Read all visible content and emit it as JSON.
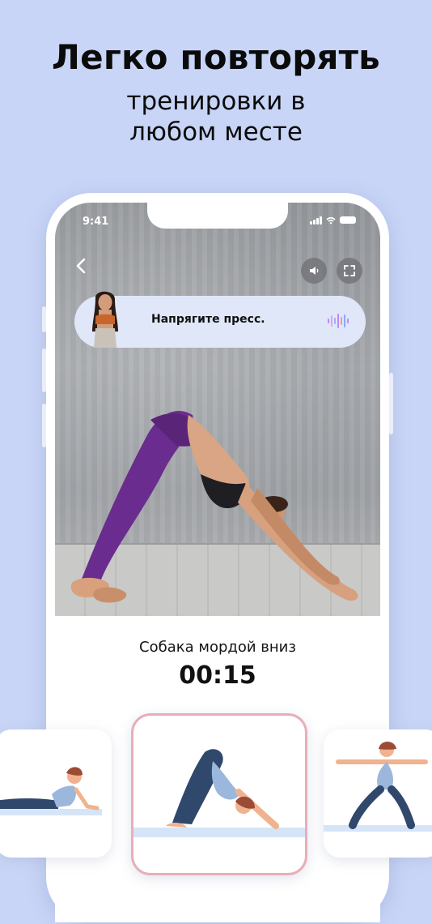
{
  "headline": {
    "title": "Легко повторять",
    "subtitle_line1": "тренировки в",
    "subtitle_line2": "любом месте"
  },
  "status_bar": {
    "time": "9:41"
  },
  "video_controls": {
    "back_icon": "chevron-left-icon",
    "sound_icon": "speaker-icon",
    "fullscreen_icon": "fullscreen-icon"
  },
  "coach_bubble": {
    "message": "Напрягите пресс.",
    "icon": "voice-wave-icon"
  },
  "exercise": {
    "name": "Собака мордой вниз",
    "timer": "00:15"
  },
  "pose_cards": [
    {
      "pose": "cobra-pose-icon",
      "selected": false
    },
    {
      "pose": "downward-dog-pose-icon",
      "selected": true
    },
    {
      "pose": "warrior-pose-icon",
      "selected": false
    }
  ],
  "colors": {
    "background": "#c8d5f7",
    "selected_border": "#e7aeb8",
    "pill": "#dfe7f8",
    "leggings": "#6a2c8e"
  }
}
